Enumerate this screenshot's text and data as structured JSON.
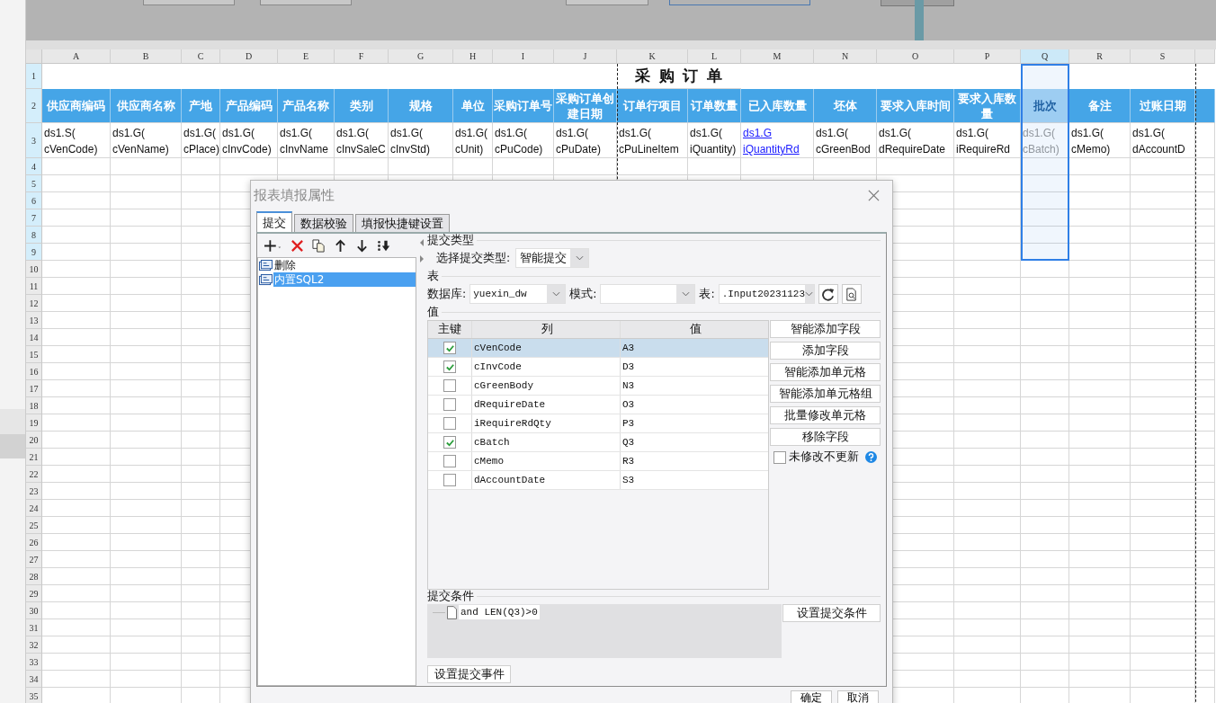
{
  "sheet": {
    "title": "采 购 订 单",
    "columns": [
      {
        "letter": "A",
        "header": "供应商编码",
        "formula": "ds1.S(\ncVenCode)",
        "kind": "text",
        "selected": false
      },
      {
        "letter": "B",
        "header": "供应商名称",
        "formula": "ds1.G(\ncVenName)",
        "kind": "text",
        "selected": false
      },
      {
        "letter": "C",
        "header": "产地",
        "formula": "ds1.G(\ncPlace)",
        "kind": "text",
        "selected": false
      },
      {
        "letter": "D",
        "header": "产品编码",
        "formula": "ds1.G(\ncInvCode)",
        "kind": "text",
        "selected": false
      },
      {
        "letter": "E",
        "header": "产品名称",
        "formula": "ds1.G(\ncInvName",
        "kind": "text",
        "selected": false
      },
      {
        "letter": "F",
        "header": "类别",
        "formula": "ds1.G(\ncInvSaleC",
        "kind": "text",
        "selected": false
      },
      {
        "letter": "G",
        "header": "规格",
        "formula": "ds1.G(\ncInvStd)",
        "kind": "text",
        "selected": false
      },
      {
        "letter": "H",
        "header": "单位",
        "formula": "ds1.G(\ncUnit)",
        "kind": "text",
        "selected": false
      },
      {
        "letter": "I",
        "header": "采购订单号",
        "formula": "ds1.G(\ncPuCode)",
        "kind": "text",
        "selected": false
      },
      {
        "letter": "J",
        "header": "采购订单创建日期",
        "formula": "ds1.G(\ncPuDate)",
        "kind": "text",
        "selected": false
      },
      {
        "letter": "K",
        "header": "订单行项目",
        "formula": "ds1.G(\ncPuLineItem",
        "kind": "text",
        "selected": false
      },
      {
        "letter": "L",
        "header": "订单数量",
        "formula": "ds1.G(\niQuantity)",
        "kind": "text",
        "selected": false
      },
      {
        "letter": "M",
        "header": "已入库数量",
        "formula": "ds1.G\niQuantityRd",
        "kind": "link",
        "selected": false
      },
      {
        "letter": "N",
        "header": "坯体",
        "formula": "ds1.G(\ncGreenBod",
        "kind": "text",
        "selected": false
      },
      {
        "letter": "O",
        "header": "要求入库时间",
        "formula": "ds1.G(\ndRequireDate",
        "kind": "text",
        "selected": false
      },
      {
        "letter": "P",
        "header": "要求入库数量",
        "formula": "ds1.G(\niRequireRd",
        "kind": "text",
        "selected": false
      },
      {
        "letter": "Q",
        "header": "批次",
        "formula": "ds1.G(\ncBatch)",
        "kind": "text",
        "selected": true
      },
      {
        "letter": "R",
        "header": "备注",
        "formula": "ds1.G(\ncMemo)",
        "kind": "text",
        "selected": false
      },
      {
        "letter": "S",
        "header": "过账日期",
        "formula": "ds1.G(\ndAccountD",
        "kind": "text",
        "selected": false
      }
    ],
    "row_numbers": [
      "1",
      "2",
      "3",
      "4",
      "5",
      "6",
      "7",
      "8",
      "9",
      "10",
      "11",
      "12",
      "13",
      "14",
      "15",
      "16",
      "17",
      "18",
      "19",
      "20",
      "21",
      "22",
      "23",
      "24",
      "25",
      "26",
      "27",
      "28",
      "29",
      "30",
      "31",
      "32",
      "33",
      "34",
      "35"
    ]
  },
  "dialog": {
    "title": "报表填报属性",
    "tabs": [
      {
        "label": "提交",
        "selected": true
      },
      {
        "label": "数据校验",
        "selected": false
      },
      {
        "label": "填报快捷键设置",
        "selected": false
      }
    ],
    "submissions": [
      {
        "label": "删除",
        "selected": false
      },
      {
        "label": "内置SQL2",
        "selected": true
      }
    ],
    "submit_type": {
      "section": "提交类型",
      "label": "选择提交类型:",
      "value": "智能提交"
    },
    "table_section": {
      "section": "表",
      "database_label": "数据库:",
      "database": "yuexin_dw",
      "schema_label": "模式:",
      "table_label": "表:",
      "table": ".Input20231123"
    },
    "values": {
      "section": "值",
      "columns": [
        "主键",
        "列",
        "值"
      ],
      "rows": [
        {
          "key": true,
          "column": "cVenCode",
          "value": "A3",
          "selected": true
        },
        {
          "key": true,
          "column": "cInvCode",
          "value": "D3",
          "selected": false
        },
        {
          "key": false,
          "column": "cGreenBody",
          "value": "N3",
          "selected": false
        },
        {
          "key": false,
          "column": "dRequireDate",
          "value": "O3",
          "selected": false
        },
        {
          "key": false,
          "column": "iRequireRdQty",
          "value": "P3",
          "selected": false
        },
        {
          "key": true,
          "column": "cBatch",
          "value": "Q3",
          "selected": false
        },
        {
          "key": false,
          "column": "cMemo",
          "value": "R3",
          "selected": false
        },
        {
          "key": false,
          "column": "dAccountDate",
          "value": "S3",
          "selected": false
        }
      ]
    },
    "actions": [
      "智能添加字段",
      "添加字段",
      "智能添加单元格",
      "智能添加单元格组",
      "批量修改单元格",
      "移除字段"
    ],
    "skip_unchanged": {
      "label": "未修改不更新",
      "checked": false
    },
    "condition": {
      "section": "提交条件",
      "items": [
        "and LEN(Q3)>0"
      ],
      "button": "设置提交条件"
    },
    "event_button": "设置提交事件",
    "footer": [
      "确定",
      "取消"
    ]
  }
}
